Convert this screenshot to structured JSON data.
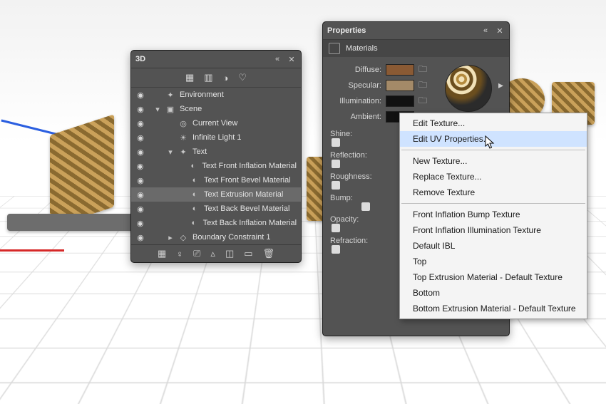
{
  "panel3d": {
    "title": "3D",
    "items": [
      {
        "label": "Environment",
        "icon": "✦",
        "indent": 0,
        "twist": ""
      },
      {
        "label": "Scene",
        "icon": "▣",
        "indent": 0,
        "twist": "▾"
      },
      {
        "label": "Current View",
        "icon": "◎",
        "indent": 1,
        "twist": ""
      },
      {
        "label": "Infinite Light 1",
        "icon": "☀",
        "indent": 1,
        "twist": ""
      },
      {
        "label": "Text",
        "icon": "✦",
        "indent": 1,
        "twist": "▾"
      },
      {
        "label": "Text Front Inflation Material",
        "icon": "◐",
        "indent": 2,
        "twist": ""
      },
      {
        "label": "Text Front Bevel Material",
        "icon": "◐",
        "indent": 2,
        "twist": ""
      },
      {
        "label": "Text Extrusion Material",
        "icon": "◐",
        "indent": 2,
        "twist": "",
        "sel": true
      },
      {
        "label": "Text Back Bevel Material",
        "icon": "◐",
        "indent": 2,
        "twist": ""
      },
      {
        "label": "Text Back Inflation Material",
        "icon": "◐",
        "indent": 2,
        "twist": ""
      },
      {
        "label": "Boundary Constraint 1",
        "icon": "◇",
        "indent": 1,
        "twist": "▸"
      }
    ]
  },
  "props": {
    "title": "Properties",
    "subtitle": "Materials",
    "rows": {
      "diffuse": "Diffuse:",
      "specular": "Specular:",
      "illumination": "Illumination:",
      "ambient": "Ambient:"
    },
    "colors": {
      "diffuse": "#8a5a34",
      "specular": "#a48a68",
      "illumination": "#111111",
      "ambient": "#111111"
    },
    "sliders": [
      "Shine:",
      "Reflection:",
      "Roughness:",
      "Bump:",
      "Opacity:",
      "Refraction:"
    ]
  },
  "menu": {
    "items": [
      {
        "label": "Edit Texture..."
      },
      {
        "label": "Edit UV Properties...",
        "hl": true
      },
      {
        "sep": true
      },
      {
        "label": "New Texture..."
      },
      {
        "label": "Replace Texture..."
      },
      {
        "label": "Remove Texture"
      },
      {
        "sep": true
      },
      {
        "label": "Front Inflation Bump Texture"
      },
      {
        "label": "Front Inflation Illumination Texture"
      },
      {
        "label": "Default IBL"
      },
      {
        "label": "Top"
      },
      {
        "label": "Top Extrusion Material - Default Texture"
      },
      {
        "label": "Bottom"
      },
      {
        "label": "Bottom Extrusion Material - Default Texture"
      }
    ]
  }
}
